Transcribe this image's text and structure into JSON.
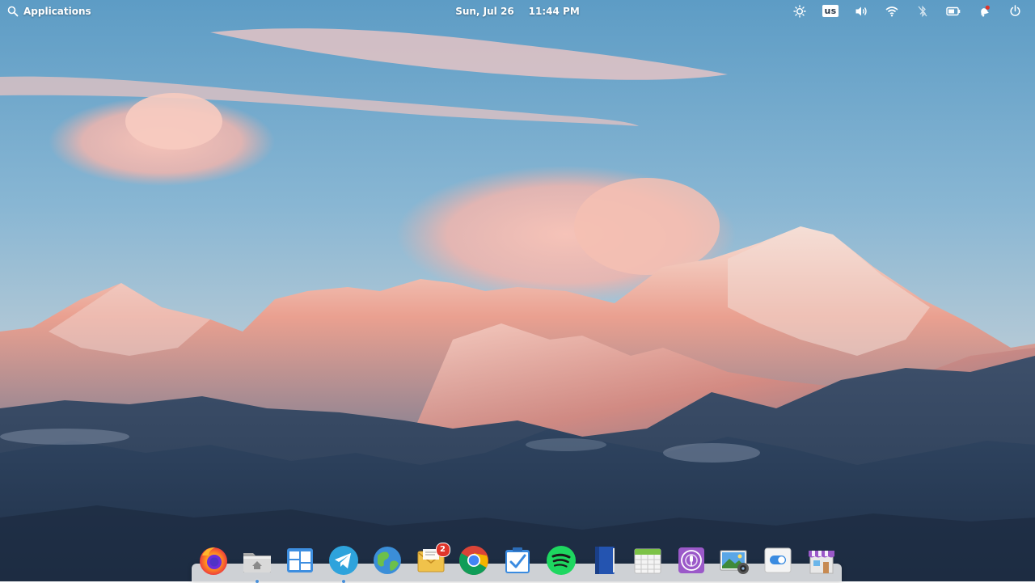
{
  "panel": {
    "applications_label": "Applications",
    "date": "Sun, Jul 26",
    "time": "11:44 PM",
    "keyboard_layout": "us"
  },
  "indicators": [
    {
      "name": "night-light-icon"
    },
    {
      "name": "keyboard-layout"
    },
    {
      "name": "volume-icon"
    },
    {
      "name": "wifi-icon"
    },
    {
      "name": "bluetooth-off-icon"
    },
    {
      "name": "battery-icon"
    },
    {
      "name": "notifications-icon"
    },
    {
      "name": "power-icon"
    }
  ],
  "dock": {
    "apps": [
      {
        "name": "firefox",
        "running": false
      },
      {
        "name": "files",
        "running": true
      },
      {
        "name": "multitasking-view",
        "running": false
      },
      {
        "name": "telegram",
        "running": true
      },
      {
        "name": "web-browser",
        "running": false
      },
      {
        "name": "mail",
        "running": false,
        "badge": "2"
      },
      {
        "name": "chrome",
        "running": false
      },
      {
        "name": "tasks",
        "running": false
      },
      {
        "name": "spotify",
        "running": false
      },
      {
        "name": "notebook",
        "running": false
      },
      {
        "name": "calendar",
        "running": false
      },
      {
        "name": "podcasts",
        "running": false
      },
      {
        "name": "photos",
        "running": false
      },
      {
        "name": "system-settings",
        "running": false
      },
      {
        "name": "appcenter",
        "running": false
      }
    ]
  },
  "colors": {
    "sky_top": "#5f9ec6",
    "sky_bottom": "#a9c4d5",
    "badge": "#e0352b",
    "running_indicator": "#4a90d9"
  }
}
